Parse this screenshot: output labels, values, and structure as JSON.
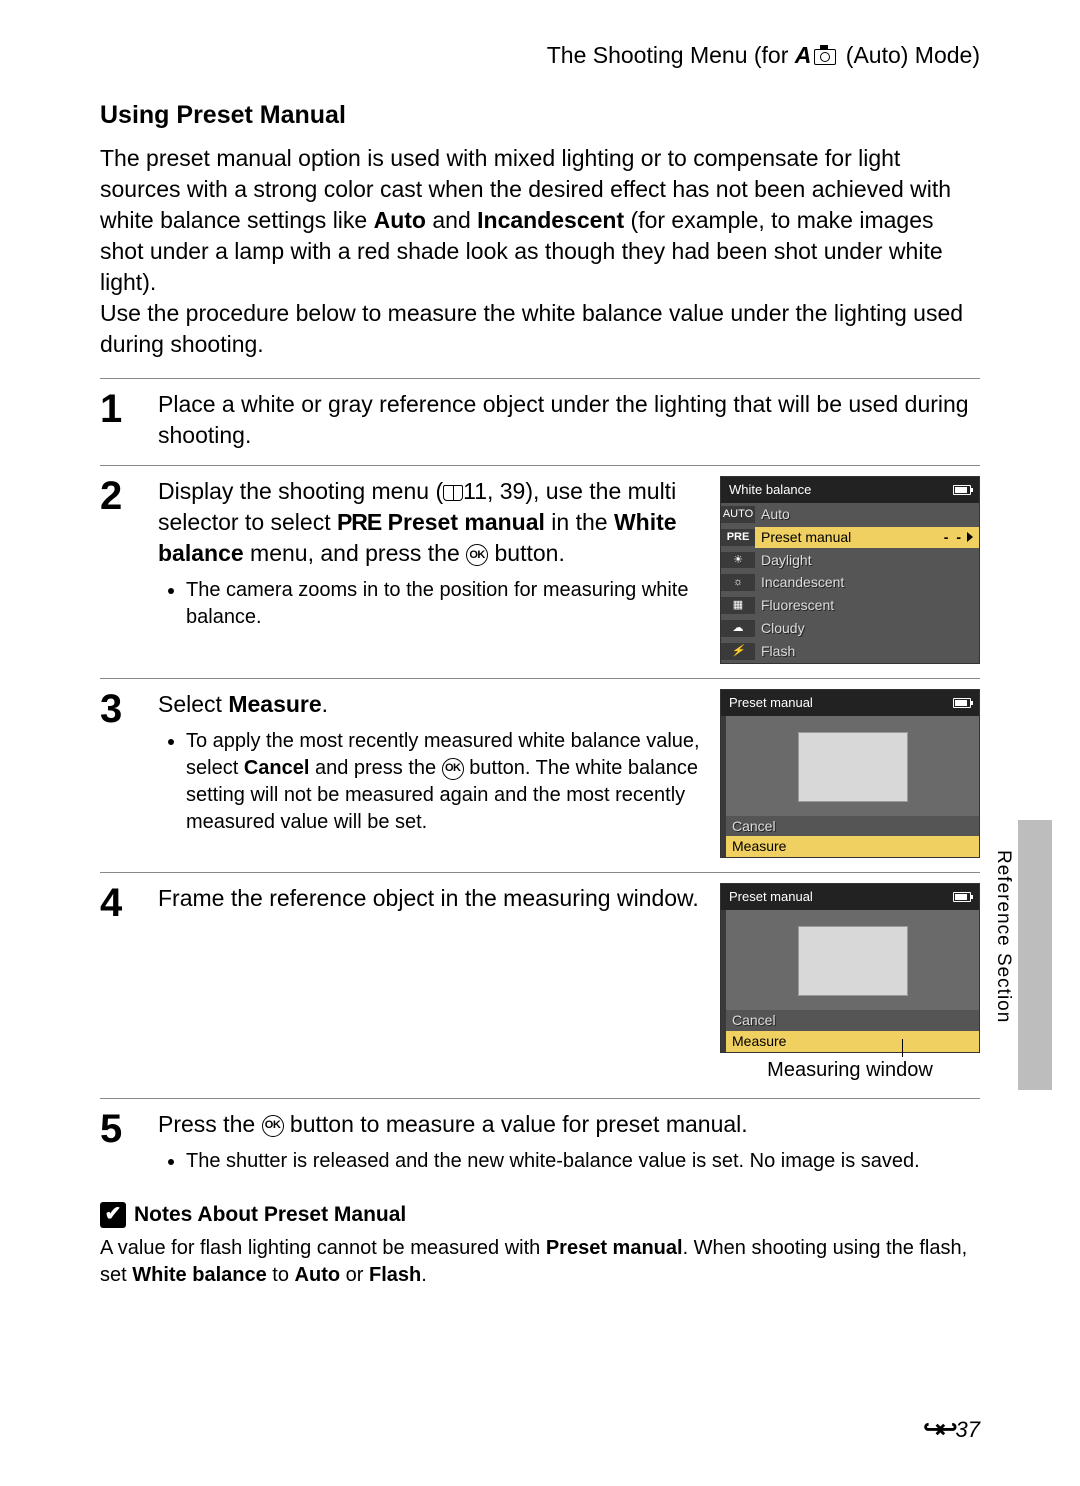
{
  "header": {
    "title_pre": "The Shooting Menu (for ",
    "title_mode_letter": "A",
    "title_post": " (Auto) Mode)"
  },
  "section_title": "Using Preset Manual",
  "intro": {
    "p1a": "The preset manual option is used with mixed lighting or to compensate for light sources with a strong color cast when the desired effect has not been achieved with white balance settings like ",
    "p1b": "Auto",
    "p1c": " and ",
    "p1d": "Incandescent",
    "p1e": " (for example, to make images shot under a lamp with a red shade look as though they had been shot under white light).",
    "p2": "Use the procedure below to measure the white balance value under the lighting used during shooting."
  },
  "steps": {
    "s1": {
      "num": "1",
      "text": "Place a white or gray reference object under the lighting that will be used during shooting."
    },
    "s2": {
      "num": "2",
      "text_a": "Display the shooting menu (",
      "text_b": "11, 39), use the multi selector to select ",
      "pre": "PRE",
      "text_c": " Preset manual",
      "text_d": " in the ",
      "text_e": "White balance",
      "text_f": " menu, and press the ",
      "text_g": " button.",
      "bullet": "The camera zooms in to the position for measuring white balance."
    },
    "s3": {
      "num": "3",
      "title_a": "Select ",
      "title_b": "Measure",
      "title_c": ".",
      "bullet_a": "To apply the most recently measured white balance value, select ",
      "bullet_b": "Cancel",
      "bullet_c": " and press the ",
      "bullet_d": " button. The white balance setting will not be measured again and the most recently measured value will be set."
    },
    "s4": {
      "num": "4",
      "text": "Frame the reference object in the measuring window.",
      "caption": "Measuring window"
    },
    "s5": {
      "num": "5",
      "text_a": "Press the ",
      "text_b": " button to measure a value for preset manual.",
      "bullet": "The shutter is released and the new white-balance value is set. No image is saved."
    }
  },
  "screen_wb": {
    "title": "White balance",
    "items": {
      "auto_icon": "AUTO",
      "auto": "Auto",
      "pre_icon": "PRE",
      "pre": "Preset manual",
      "daylight": "Daylight",
      "incandescent": "Incandescent",
      "fluorescent": "Fluorescent",
      "cloudy": "Cloudy",
      "flash": "Flash"
    },
    "indicator": "- -"
  },
  "screen_pm": {
    "title": "Preset manual",
    "cancel": "Cancel",
    "measure": "Measure"
  },
  "notes": {
    "title": "Notes About Preset Manual",
    "body_a": "A value for flash lighting cannot be measured with ",
    "body_b": "Preset manual",
    "body_c": ". When shooting using the flash, set ",
    "body_d": "White balance",
    "body_e": " to ",
    "body_f": "Auto",
    "body_g": " or ",
    "body_h": "Flash",
    "body_i": "."
  },
  "side_label": "Reference Section",
  "page_number": "37",
  "ok_label": "OK",
  "check_mark": "✔"
}
